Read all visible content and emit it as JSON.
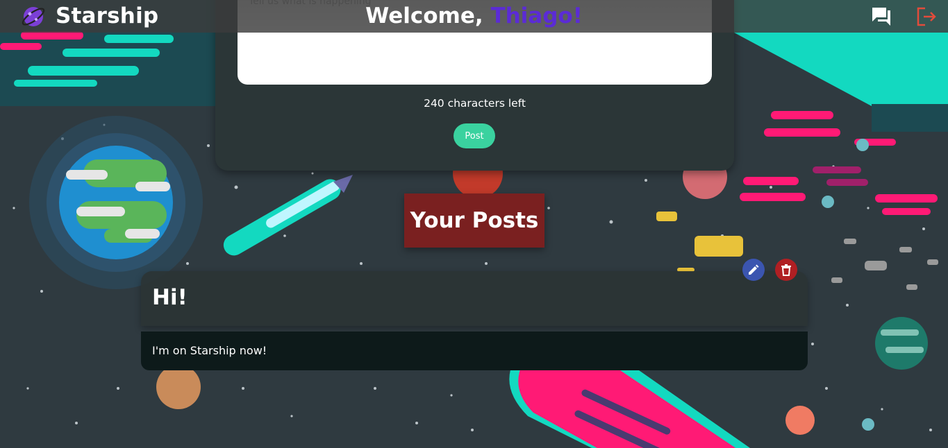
{
  "app": {
    "brand": "Starship"
  },
  "header": {
    "welcome_prefix": "Welcome, ",
    "username": "Thiago!",
    "username_color": "#5b2bd6",
    "icons": [
      "planet-logo-icon",
      "chat-icon",
      "logout-icon"
    ]
  },
  "compose": {
    "placeholder": "Tell us what is happening",
    "value": "",
    "chars_left_text": "240 characters left",
    "post_label": "Post",
    "post_color": "#3ad29f"
  },
  "posts_section": {
    "heading": "Your Posts",
    "heading_color": "#7a2020"
  },
  "posts": [
    {
      "title": "Hi!",
      "body": "I'm on Starship now!",
      "actions": [
        "edit-icon",
        "delete-icon"
      ]
    }
  ],
  "colors": {
    "background": "#2f3a40",
    "accent_teal": "#13d9c0",
    "accent_pink": "#ff1a75",
    "edit": "#3b55b0",
    "delete": "#b01f23"
  }
}
